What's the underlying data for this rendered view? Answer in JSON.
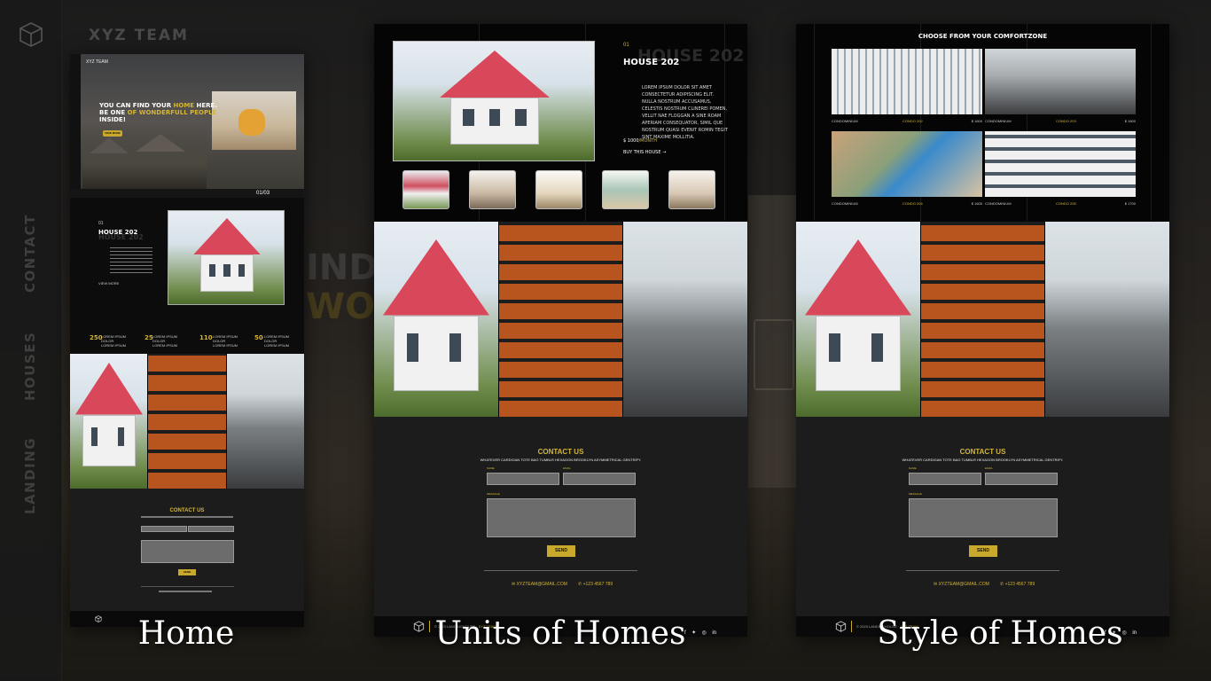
{
  "brand": "XYZ TEAM",
  "sidebar": {
    "nav": [
      "CONTACT",
      "HOUSES",
      "LANDING"
    ]
  },
  "background_text": {
    "line1": "IND Y",
    "line2": "WONI"
  },
  "captions": {
    "home": "Home",
    "units": "Units of Homes",
    "style": "Style of Homes"
  },
  "home_mock": {
    "brand": "XYZ TEAM",
    "hero_line1": "YOU CAN FIND YOUR",
    "hero_home": "HOME",
    "hero_here": "HERE.",
    "hero_line2": "BE ONE",
    "hero_of": "OF WONDERFULL PEOPLE",
    "hero_line3": "INSIDE!",
    "hero_button": "VIEW MORE",
    "slider_counter": "01",
    "slider_total": "/03",
    "feature_num": "01",
    "feature_title": "HOUSE 202",
    "feature_ghost": "HOUSE 202",
    "feature_link": "VIEW MORE",
    "stats": [
      {
        "num": "250",
        "label": "LOREM IPSUM DOLOR LOREM IPSUM"
      },
      {
        "num": "25",
        "label": "LOREM IPSUM DOLOR LOREM IPSUM"
      },
      {
        "num": "110",
        "label": "LOREM IPSUM DOLOR LOREM IPSUM"
      },
      {
        "num": "50",
        "label": "LOREM IPSUM DOLOR LOREM IPSUM"
      }
    ],
    "contact_title": "CONTACT US",
    "contact_send": "SEND"
  },
  "units_mock": {
    "num": "01",
    "title": "HOUSE 202",
    "ghost": "HOUSE 202",
    "description": "LOREM IPSUM DOLOR SIT AMET CONSECTETUR ADIPISCING ELIT. NULLA NOSTRUM ACCUSAMUS, CELESTIS NOSTRUM CLINEREI POMEN, VELLIT NAE FLOGGAN A SINE ROAM APERIAM CONSEQUATOR, SIMIL QUE NOSTRUM QUASI EVENIT ROMIN TEGIT SINT MAXIME MOLLITIA.",
    "price_label": "$ 1000",
    "price_suffix": "/MONTH",
    "buy_label": "BUY THIS HOUSE",
    "contact_title": "CONTACT US",
    "contact_sub": "WHATEVER CARDIGAN TOTE BAG TUMBLR HEXAGON BROOKLYN ASYMMETRICAL GENTRIFY.",
    "label_name": "NAME",
    "label_email": "EMAIL",
    "label_message": "MESSAGE",
    "send": "SEND",
    "email": "XYZTEAM@GMAIL.COM",
    "phone": "+123 4567 789",
    "footer_copy": "© 2023 LANDINGHOUSE",
    "footer_brand": "XYZ TEAM"
  },
  "style_mock": {
    "heading": "CHOOSE FROM YOUR COMFORTZONE",
    "condos": [
      {
        "type": "CONDOMINIUM",
        "name": "CONDO 202",
        "price": "$ 1600"
      },
      {
        "type": "CONDOMINIUM",
        "name": "CONDO 203",
        "price": "$ 1800"
      },
      {
        "type": "CONDOMINIUM",
        "name": "CONDO 204",
        "price": "$ 1600"
      },
      {
        "type": "CONDOMINIUM",
        "name": "CONDO 205",
        "price": "$ 1700"
      }
    ],
    "contact_title": "CONTACT US",
    "contact_sub": "WHATEVER CARDIGAN TOTE BAG TUMBLR HEXAGON BROOKLYN ASYMMETRICAL GENTRIFY.",
    "label_name": "NAME",
    "label_email": "EMAIL",
    "label_message": "MESSAGE",
    "send": "SEND",
    "email": "XYZTEAM@GMAIL.COM",
    "phone": "+123 4567 789",
    "footer_copy": "© 2023 LANDINGHOUSE",
    "footer_brand": "XYZ TEAM"
  },
  "colors": {
    "accent": "#c9a92c",
    "roof": "#d9475a",
    "brick": "#b8551f"
  },
  "icons": [
    "cube-logo-icon",
    "mail-icon",
    "phone-icon",
    "facebook-icon",
    "twitter-icon",
    "instagram-icon",
    "linkedin-icon",
    "arrow-right-icon"
  ]
}
